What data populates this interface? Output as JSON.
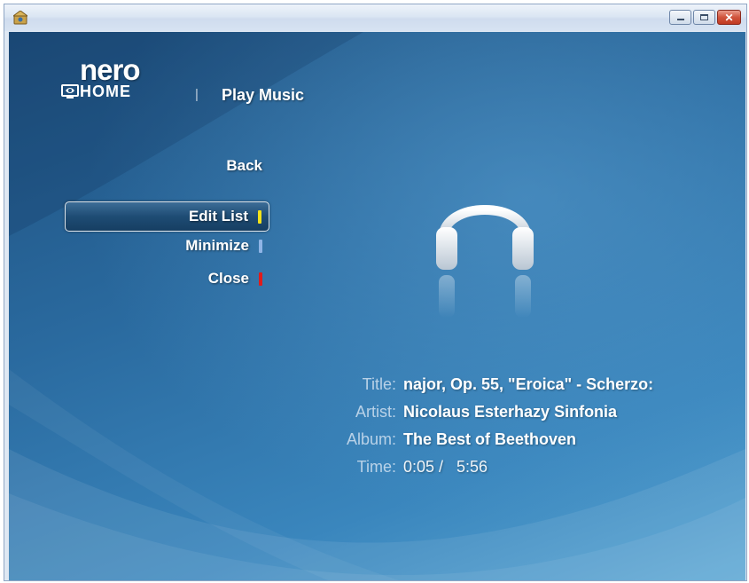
{
  "window": {
    "icon": "nero-home-icon",
    "controls": [
      "minimize",
      "maximize",
      "close"
    ]
  },
  "brand": {
    "logo_top": "nero",
    "logo_bottom": "HOME",
    "separator": "|",
    "section": "Play Music"
  },
  "menu": {
    "back": "Back",
    "items": [
      {
        "label": "Edit List",
        "key_color": "#f2e21a",
        "selected": true
      },
      {
        "label": "Minimize",
        "key_color": "#8fb4e6",
        "selected": false
      },
      {
        "label": "Close",
        "key_color": "#e01b1b",
        "selected": false
      }
    ]
  },
  "now_playing": {
    "icon": "headphones-icon",
    "title_label": "Title:",
    "title_value": "najor, Op. 55, \"Eroica\" - Scherzo:",
    "artist_label": "Artist:",
    "artist_value": "Nicolaus Esterhazy Sinfonia",
    "album_label": "Album:",
    "album_value": "The Best of Beethoven",
    "time_label": "Time:",
    "time_value": "0:05 /   5:56"
  }
}
